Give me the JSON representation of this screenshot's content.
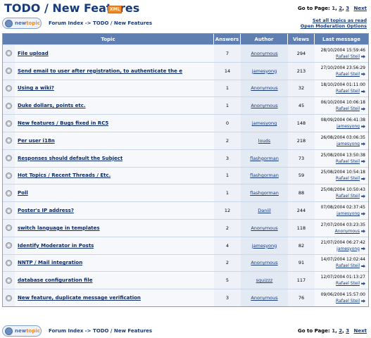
{
  "header": {
    "title": "TODO / New Features",
    "xml_badge": "XML",
    "goto_label": "Go to Page:",
    "pages": [
      "1",
      "2",
      "3"
    ],
    "page_sep": ",",
    "next": "Next"
  },
  "toolbar": {
    "newtopic_prefix": "new",
    "newtopic_suffix": "topic",
    "breadcrumb": "Forum Index -> TODO / New Features",
    "mark_read": "Set all topics as read",
    "open_moderation": "Open Moderation Options"
  },
  "table": {
    "columns": [
      "Topic",
      "Answers",
      "Author",
      "Views",
      "Last message"
    ],
    "rows": [
      {
        "topic": "File upload",
        "answers": "7",
        "author": "Anonymous",
        "views": "294",
        "date": "28/10/2004 15:59:46",
        "poster": "Rafael Steil"
      },
      {
        "topic": "Send email to user after registration, to authenticate the e",
        "answers": "14",
        "author": "jamesyong",
        "views": "213",
        "date": "27/10/2004 23:56:29",
        "poster": "Rafael Steil"
      },
      {
        "topic": "Using a wiki?",
        "answers": "1",
        "author": "Anonymous",
        "views": "32",
        "date": "18/10/2004 01:11:00",
        "poster": "Rafael Steil"
      },
      {
        "topic": "Duke dollars, points etc.",
        "answers": "1",
        "author": "Anonymous",
        "views": "45",
        "date": "06/10/2004 10:06:18",
        "poster": "Rafael Steil"
      },
      {
        "topic": "New features / Bugs fixed in RC5",
        "answers": "0",
        "author": "jamesyong",
        "views": "148",
        "date": "08/09/2004 06:41:38",
        "poster": "jamesyong"
      },
      {
        "topic": "Per user i18n",
        "answers": "2",
        "author": "louds",
        "views": "218",
        "date": "26/08/2004 03:06:35",
        "poster": "jamesyong"
      },
      {
        "topic": "Responses should default the Subject",
        "answers": "3",
        "author": "flashgorman",
        "views": "73",
        "date": "25/08/2004 13:50:38",
        "poster": "Rafael Steil"
      },
      {
        "topic": "Hot Topics / Recent Threads / Etc.",
        "answers": "1",
        "author": "flashgorman",
        "views": "59",
        "date": "25/08/2004 10:54:18",
        "poster": "Rafael Steil"
      },
      {
        "topic": "Poll",
        "answers": "1",
        "author": "flashgorman",
        "views": "88",
        "date": "25/08/2004 10:50:43",
        "poster": "Rafael Steil"
      },
      {
        "topic": "Poster's IP address?",
        "answers": "12",
        "author": "Daniil",
        "views": "244",
        "date": "07/08/2004 02:37:45",
        "poster": "jamesyong"
      },
      {
        "topic": "switch language in templates",
        "answers": "2",
        "author": "Anonymous",
        "views": "118",
        "date": "27/07/2004 03:23:35",
        "poster": "Anonymous"
      },
      {
        "topic": "Identify Moderator in Posts",
        "answers": "4",
        "author": "jamesyong",
        "views": "82",
        "date": "21/07/2004 06:27:42",
        "poster": "jamesyong"
      },
      {
        "topic": "NNTP / Mail integration",
        "answers": "2",
        "author": "Anonymous",
        "views": "91",
        "date": "14/07/2004 12:02:44",
        "poster": "Rafael Steil"
      },
      {
        "topic": "database configuration file",
        "answers": "5",
        "author": "squizzz",
        "views": "117",
        "date": "12/07/2004 01:13:27",
        "poster": "Rafael Steil"
      },
      {
        "topic": "New feature, duplicate message verification",
        "answers": "3",
        "author": "Anonymous",
        "views": "76",
        "date": "09/06/2004 15:57:00",
        "poster": "Rafael Steil"
      }
    ]
  },
  "colors": {
    "header_bg": "#5f7fb3",
    "title": "#173a7a",
    "accent": "#f08a24"
  }
}
